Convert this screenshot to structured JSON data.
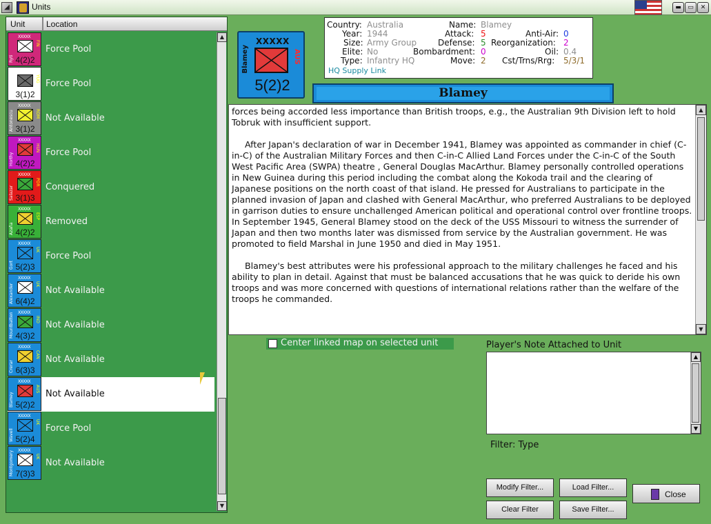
{
  "window": {
    "title": "Units"
  },
  "columns": {
    "unit": "Unit",
    "location": "Location"
  },
  "units": [
    {
      "side": "Ryti",
      "nat": "FIN",
      "size": "XXXXX",
      "strength": "4(2)2",
      "location": "Force Pool",
      "color": "#d0287a",
      "box": "#ffffff"
    },
    {
      "side": "Prince Paul",
      "nat": "YUG",
      "size": "XXXXX",
      "strength": "3(1)2",
      "location": "Force Pool",
      "color": "#ffffff",
      "box": "#6a6a6a"
    },
    {
      "side": "Antonescu",
      "nat": "ROM",
      "size": "XXXXX",
      "strength": "3(1)2",
      "location": "Not Available",
      "color": "#8a8a8a",
      "box": "#f0f030"
    },
    {
      "side": "Horthy",
      "nat": "HUN",
      "size": "XXXXX",
      "strength": "4(2)2",
      "location": "Force Pool",
      "color": "#c018c0",
      "box": "#e23a3a"
    },
    {
      "side": "Salazar",
      "nat": "POR",
      "size": "XXXXX",
      "strength": "3(1)3",
      "location": "Conquered",
      "color": "#e21a1a",
      "box": "#3aa83a"
    },
    {
      "side": "Azaña",
      "nat": "ESP",
      "size": "XXXXX",
      "strength": "4(2)2",
      "location": "Removed",
      "color": "#38b038",
      "box": "#f0d030"
    },
    {
      "side": "Gort",
      "nat": "UK",
      "size": "XXXXX",
      "strength": "5(2)3",
      "location": "Force Pool",
      "color": "#1b8bd8",
      "box": "#1b8bd8"
    },
    {
      "side": "Alexander",
      "nat": "UK",
      "size": "XXXXX",
      "strength": "6(4)2",
      "location": "Not Available",
      "color": "#1b8bd8",
      "box": "#ffffff"
    },
    {
      "side": "Mountbatten",
      "nat": "IND",
      "size": "XXXXX",
      "strength": "4(3)2",
      "location": "Not Available",
      "color": "#1b8bd8",
      "box": "#3aa83a"
    },
    {
      "side": "Crerar",
      "nat": "CAN",
      "size": "XXXXX",
      "strength": "6(3)3",
      "location": "Not Available",
      "color": "#1b8bd8",
      "box": "#f0d030"
    },
    {
      "side": "Blamey",
      "nat": "AUS",
      "size": "XXXXX",
      "strength": "5(2)2",
      "location": "Not Available",
      "color": "#1b8bd8",
      "box": "#e23a3a"
    },
    {
      "side": "Wavell",
      "nat": "UK",
      "size": "XXXXX",
      "strength": "5(2)4",
      "location": "Force Pool",
      "color": "#1b8bd8",
      "box": "#1b8bd8"
    },
    {
      "side": "Montgomery",
      "nat": "UK",
      "size": "XXXXX",
      "strength": "7(3)3",
      "location": "Not Available",
      "color": "#1b8bd8",
      "box": "#ffffff"
    }
  ],
  "selected": {
    "counter": {
      "side": "Blamey",
      "nat": "AUS",
      "size": "XXXXX",
      "strength": "5(2)2"
    },
    "info": {
      "country_label": "Country:",
      "country": "Australia",
      "year_label": "Year:",
      "year": "1944",
      "size_label": "Size:",
      "size": "Army Group",
      "elite_label": "Elite:",
      "elite": "No",
      "type_label": "Type:",
      "type": "Infantry HQ",
      "name_label": "Name:",
      "name": "Blamey",
      "attack_label": "Attack:",
      "attack": "5",
      "defense_label": "Defense:",
      "defense": "5",
      "bombardment_label": "Bombardment:",
      "bombardment": "0",
      "move_label": "Move:",
      "move": "2",
      "antiair_label": "Anti-Air:",
      "antiair": "0",
      "reorg_label": "Reorganization:",
      "reorg": "2",
      "oil_label": "Oil:",
      "oil": "0.4",
      "cst_label": "Cst/Trns/Rrg:",
      "cst": "5/3/1",
      "hq_link": "HQ Supply Link"
    },
    "name_banner": "Blamey",
    "bio": [
      "forces being accorded less importance than British troops, e.g., the Australian 9th Division left to hold Tobruk with insufficient support.",
      "After Japan's declaration of war in December 1941, Blamey was appointed as commander in chief (C-in-C) of the Australian Military Forces and then C-in-C Allied Land Forces under the C-in-C of the South West Pacific Area (SWPA) theatre , General Douglas MacArthur.  Blamey personally controlled operations in New Guinea during this period including the combat along the Kokoda trail and the clearing of Japanese positions on the north coast of that island.  He pressed for Australians to participate in the planned invasion of Japan and clashed with General MacArthur, who preferred Australians to be deployed in garrison duties to ensure unchallenged American political and operational control over frontline troops. In September 1945, General Blamey stood on the deck of the USS Missouri to witness the surrender of Japan and then two months later was dismissed from service by the Australian government.  He was promoted to field Marshal in June 1950 and died in May 1951.",
      "Blamey's best attributes were his professional approach to the military challenges he faced and his ability to plan in detail.  Against that must be balanced accusations that he was quick to deride his own troops and was more concerned with questions of international relations rather than the welfare of the troops he commanded."
    ]
  },
  "center_map_label": "Center linked map on selected unit",
  "note_label": "Player's Note Attached to Unit",
  "filter_label": "Filter:  Type",
  "buttons": {
    "modify_filter": "Modify Filter...",
    "load_filter": "Load Filter...",
    "clear_filter": "Clear Filter",
    "save_filter": "Save Filter...",
    "close": "Close"
  }
}
